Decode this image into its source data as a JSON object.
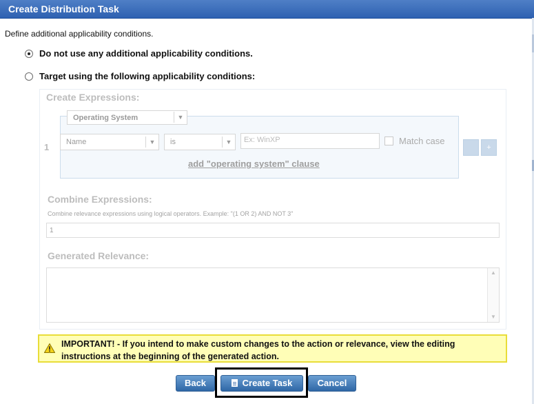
{
  "dialog": {
    "title": "Create Distribution Task"
  },
  "intro": "Define additional applicability conditions.",
  "options": [
    {
      "label": "Do not use any additional applicability conditions.",
      "selected": true
    },
    {
      "label": "Target using the following applicability conditions:",
      "selected": false
    }
  ],
  "create_expressions": {
    "title": "Create Expressions:",
    "group_select": "Operating System",
    "row_number": "1",
    "property_select": "Name",
    "operator_select": "is",
    "value_placeholder": "Ex: WinXP",
    "match_case_label": "Match case",
    "match_case_checked": false,
    "add_clause_link": "add \"operating system\" clause",
    "remove_button": "",
    "add_button": "+"
  },
  "combine_expressions": {
    "title": "Combine Expressions:",
    "hint": "Combine relevance expressions using logical operators. Example: \"(1 OR 2) AND NOT 3\"",
    "value": "1"
  },
  "generated_relevance": {
    "title": "Generated Relevance:",
    "value": ""
  },
  "warning": {
    "text": "IMPORTANT! - If you intend to make custom changes to the action or relevance, view the editing instructions at the beginning of the generated action."
  },
  "buttons": {
    "back": "Back",
    "create_task": "Create Task",
    "cancel": "Cancel"
  },
  "colors": {
    "title_bar": "#3a6cbb",
    "button": "#4a82c0",
    "warning_bg": "#fffeb7",
    "warning_border": "#e8dd38"
  }
}
